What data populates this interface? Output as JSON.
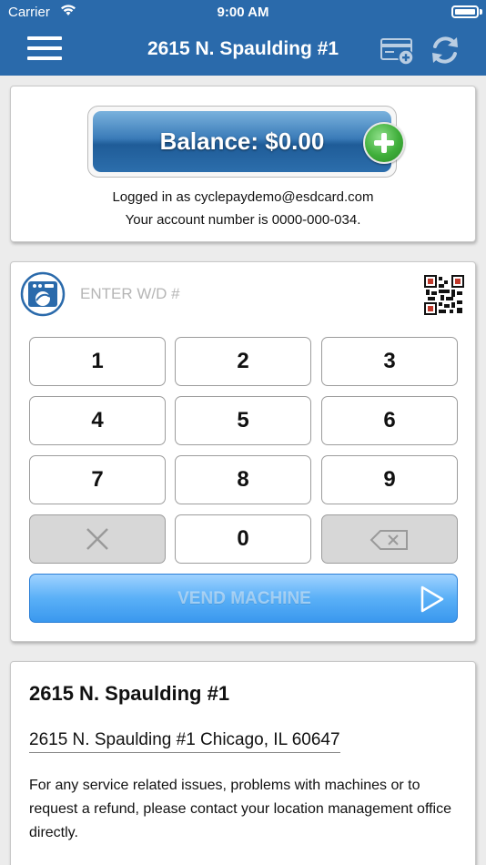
{
  "status_bar": {
    "carrier": "Carrier",
    "time": "9:00 AM"
  },
  "header": {
    "title": "2615 N. Spaulding #1",
    "menu_icon": "hamburger-menu-icon",
    "add_card_icon": "add-card-icon",
    "refresh_icon": "refresh-icon",
    "bar_color": "#2a6aab"
  },
  "balance": {
    "label": "Balance: $0.00",
    "logged_in": "Logged in as cyclepaydemo@esdcard.com",
    "account": "Your account number is 0000-000-034."
  },
  "keypad": {
    "input_placeholder": "ENTER W/D #",
    "input_value": "",
    "keys": [
      "1",
      "2",
      "3",
      "4",
      "5",
      "6",
      "7",
      "8",
      "9",
      "0"
    ],
    "vend_label": "VEND MACHINE"
  },
  "location": {
    "title": "2615 N. Spaulding #1",
    "address": "2615 N. Spaulding #1 Chicago, IL 60647",
    "info": "For any service related issues, problems with machines or to request a refund, please contact your location management office directly."
  }
}
